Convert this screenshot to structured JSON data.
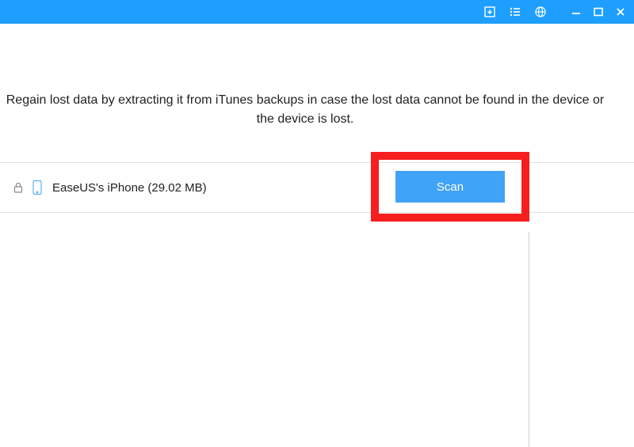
{
  "titlebar": {
    "icons": {
      "download": "download-icon",
      "list": "list-icon",
      "globe": "globe-icon"
    },
    "window": {
      "minimize": "minimize",
      "maximize": "maximize",
      "close": "close"
    }
  },
  "description": "Regain lost data by extracting it from iTunes backups in case the lost data cannot be found in the device or the device is lost.",
  "backup": {
    "name": "EaseUS's iPhone (29.02 MB)",
    "lock_icon": "lock-icon",
    "device_icon": "phone-icon"
  },
  "scan_label": "Scan",
  "colors": {
    "titlebar": "#1e9fff",
    "scan_button": "#3fa3f7",
    "highlight": "#f71e1e"
  }
}
